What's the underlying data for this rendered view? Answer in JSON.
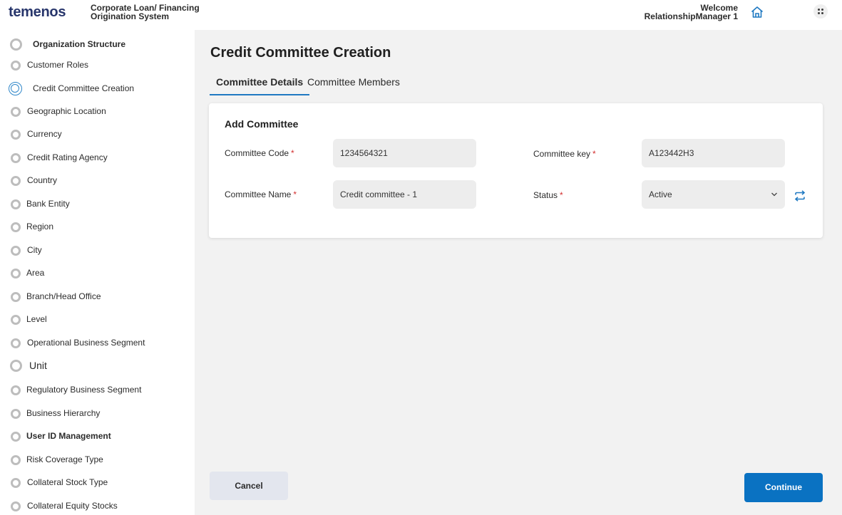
{
  "header": {
    "logo": "temenos",
    "app_title_line1": "Corporate Loan/ Financing",
    "app_title_line2": "Origination System",
    "welcome_line1": "Welcome",
    "welcome_line2": "RelationshipManager 1",
    "icons": {
      "home": "home-icon",
      "apps": "apps-grid-icon"
    }
  },
  "sidebar": {
    "items": [
      {
        "label": "Organization Structure"
      },
      {
        "label": "Customer Roles"
      },
      {
        "label": "Credit  Committee Creation",
        "active": true
      },
      {
        "label": "Geographic Location"
      },
      {
        "label": "Currency"
      },
      {
        "label": "Credit Rating Agency"
      },
      {
        "label": "Country"
      },
      {
        "label": "Bank Entity"
      },
      {
        "label": "Region"
      },
      {
        "label": "City"
      },
      {
        "label": "Area"
      },
      {
        "label": "Branch/Head Office"
      },
      {
        "label": "Level"
      },
      {
        "label": "Operational Business Segment"
      },
      {
        "label": "Unit"
      },
      {
        "label": "Regulatory Business Segment"
      },
      {
        "label": "Business Hierarchy"
      },
      {
        "label": "User ID Management"
      },
      {
        "label": "Risk Coverage Type"
      },
      {
        "label": "Collateral Stock Type"
      },
      {
        "label": "Collateral Equity Stocks"
      }
    ]
  },
  "main": {
    "page_title": "Credit Committee Creation",
    "tabs": [
      {
        "label": "Committee Details",
        "active": true
      },
      {
        "label": "Committee Members"
      }
    ],
    "form": {
      "title": "Add Committee",
      "committee_code": {
        "label": "Committee Code",
        "value": "1234564321"
      },
      "committee_key": {
        "label": "Committee key",
        "value": "A123442H3"
      },
      "committee_name": {
        "label": "Committee Name",
        "value": "Credit committee - 1"
      },
      "status": {
        "label": "Status",
        "value": "Active"
      },
      "required_mark": "*"
    },
    "buttons": {
      "cancel": "Cancel",
      "continue": "Continue"
    }
  },
  "colors": {
    "brand": "#27356b",
    "accent": "#0a72c2",
    "required": "#d32f2f"
  }
}
